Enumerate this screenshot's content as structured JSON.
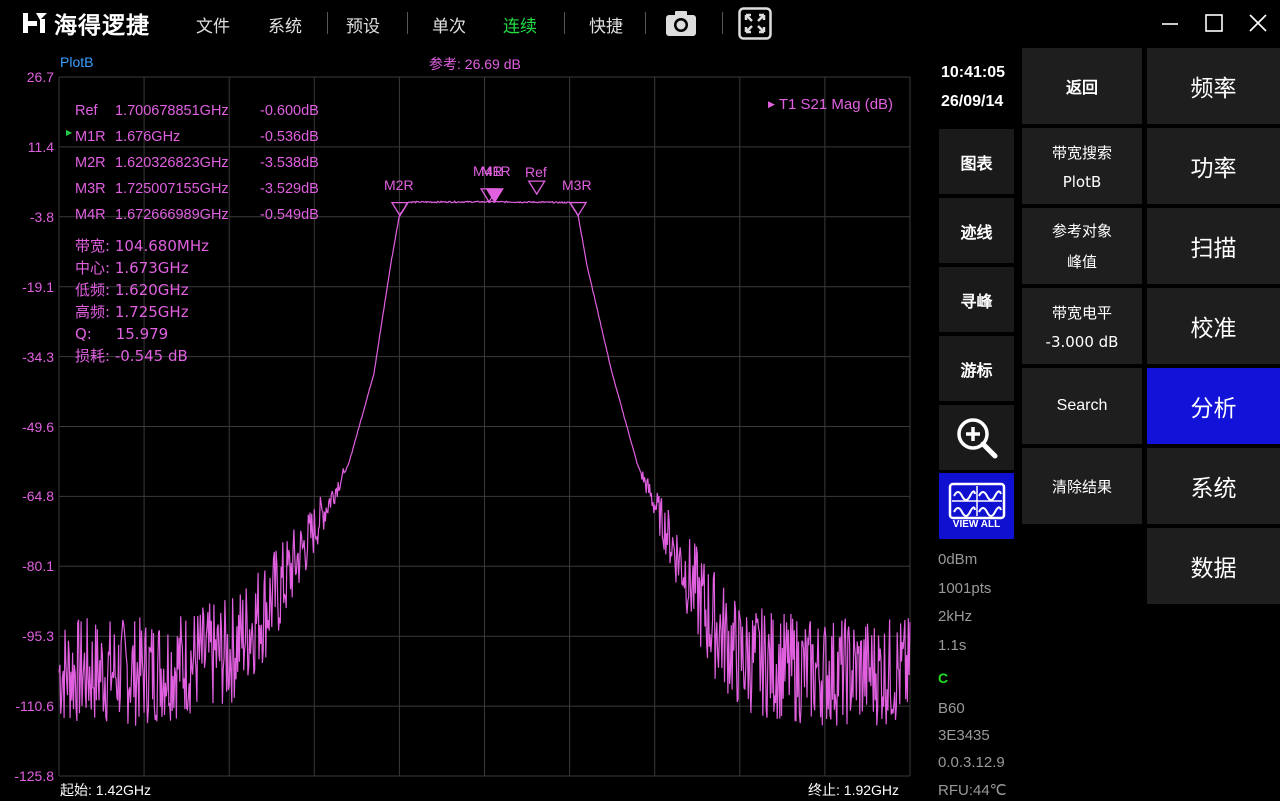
{
  "app": {
    "title": "海得逻捷"
  },
  "menu": [
    {
      "label": "文件",
      "active": false
    },
    {
      "label": "系统",
      "active": false
    },
    {
      "label": "预设",
      "active": false
    },
    {
      "label": "单次",
      "active": false
    },
    {
      "label": "连续",
      "active": true
    },
    {
      "label": "快捷",
      "active": false
    }
  ],
  "toolbar_icons": [
    "camera-icon",
    "fullscreen-icon"
  ],
  "window_controls": [
    "minimize-icon",
    "maximize-icon",
    "close-icon"
  ],
  "plot": {
    "name": "PlotB",
    "reference": "参考: 26.69 dB",
    "trace_label": "T1 S21 Mag (dB)",
    "start": "起始: 1.42GHz",
    "stop": "终止: 1.92GHz",
    "y_ticks": [
      "26.7",
      "11.4",
      "-3.8",
      "-19.1",
      "-34.3",
      "-49.6",
      "-64.8",
      "-80.1",
      "-95.3",
      "-110.6",
      "-125.8"
    ],
    "markers": [
      {
        "name": "Ref",
        "freq": "1.700678851GHz",
        "value": "-0.600dB"
      },
      {
        "name": "M1R",
        "freq": "1.676GHz",
        "value": "-0.536dB"
      },
      {
        "name": "M2R",
        "freq": "1.620326823GHz",
        "value": "-3.538dB"
      },
      {
        "name": "M3R",
        "freq": "1.725007155GHz",
        "value": "-3.529dB"
      },
      {
        "name": "M4R",
        "freq": "1.672666989GHz",
        "value": "-0.549dB"
      }
    ],
    "analysis": [
      {
        "label": "带宽:",
        "value": "104.680MHz"
      },
      {
        "label": "中心:",
        "value": "1.673GHz"
      },
      {
        "label": "低频:",
        "value": "1.620GHz"
      },
      {
        "label": "高频:",
        "value": "1.725GHz"
      },
      {
        "label": "Q:",
        "value": "15.979"
      },
      {
        "label": "损耗:",
        "value": "-0.545 dB"
      }
    ],
    "marker_tags": [
      "M2R",
      "M4R",
      "M1R",
      "Ref",
      "M3R"
    ],
    "colors": {
      "trace": "#e060e0",
      "plotname": "#3aa0ff",
      "grid": "#3a3a3a",
      "active_menu": "#22dd44",
      "active_button": "#1212d8"
    }
  },
  "chart_data": {
    "type": "line",
    "title": "",
    "series": [
      {
        "name": "T1 S21 Mag (dB)",
        "x_ghz": [
          1.42,
          1.47,
          1.52,
          1.55,
          1.57,
          1.59,
          1.605,
          1.615,
          1.62,
          1.625,
          1.65,
          1.676,
          1.7,
          1.72,
          1.725,
          1.73,
          1.745,
          1.76,
          1.78,
          1.8,
          1.82,
          1.86,
          1.92
        ],
        "y_db": [
          -103,
          -103,
          -99,
          -85,
          -72,
          -58,
          -38,
          -14,
          -3.5,
          -0.6,
          -0.55,
          -0.54,
          -0.6,
          -0.7,
          -3.5,
          -14,
          -38,
          -58,
          -75,
          -90,
          -100,
          -103,
          -103
        ]
      }
    ],
    "xlim": [
      1.42,
      1.92
    ],
    "ylim": [
      -125.8,
      26.7
    ],
    "xlabel": "",
    "ylabel": "",
    "grid": true
  },
  "status": {
    "time": "10:41:05",
    "date": "26/09/14",
    "power": "0dBm",
    "points": "1001pts",
    "ifbw": "2kHz",
    "sweep_time": "1.1s",
    "cal": "C",
    "model": "B60",
    "serial": "3E3435",
    "version": "0.0.3.12.9",
    "rfu": "RFU:44℃"
  },
  "side_buttons": [
    "图表",
    "迹线",
    "寻峰",
    "游标"
  ],
  "side_icons": [
    "zoom-in-icon",
    "view-all-icon"
  ],
  "view_all_label": "VIEW ALL",
  "mid_buttons": [
    {
      "label": "返回",
      "sub": ""
    },
    {
      "label": "带宽搜索",
      "sub": "PlotB"
    },
    {
      "label": "参考对象",
      "sub": "峰值"
    },
    {
      "label": "带宽电平",
      "sub": "-3.000 dB"
    },
    {
      "label": "Search",
      "sub": ""
    },
    {
      "label": "清除结果",
      "sub": ""
    }
  ],
  "right_buttons": [
    {
      "label": "频率",
      "active": false
    },
    {
      "label": "功率",
      "active": false
    },
    {
      "label": "扫描",
      "active": false
    },
    {
      "label": "校准",
      "active": false
    },
    {
      "label": "分析",
      "active": true
    },
    {
      "label": "系统",
      "active": false
    },
    {
      "label": "数据",
      "active": false
    }
  ]
}
